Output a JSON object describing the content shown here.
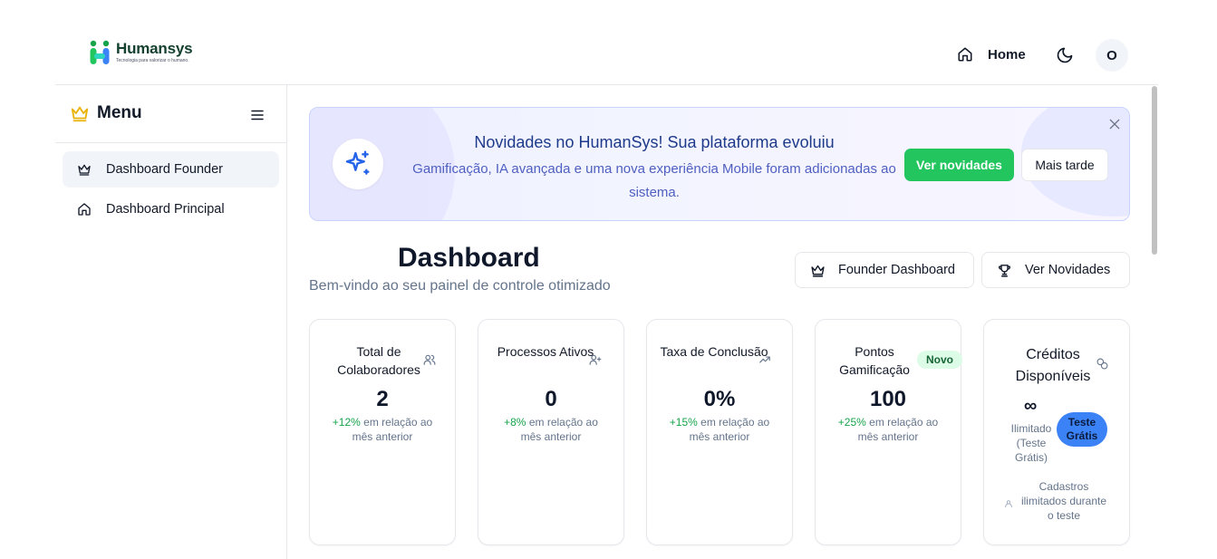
{
  "header": {
    "logo": {
      "name": "Humansys",
      "tagline": "Tecnologia para valorizar o humano."
    },
    "home_label": "Home",
    "avatar_initial": "O"
  },
  "sidebar": {
    "title": "Menu",
    "items": [
      {
        "label": "Dashboard Founder",
        "icon": "crown-icon",
        "active": true
      },
      {
        "label": "Dashboard Principal",
        "icon": "home-icon",
        "active": false
      }
    ]
  },
  "banner": {
    "title": "Novidades no HumanSys! Sua plataforma evoluiu",
    "description": "Gamificação, IA avançada e uma nova experiência Mobile foram adicionadas ao sistema.",
    "primary_button": "Ver novidades",
    "secondary_button": "Mais tarde",
    "icon": "sparkles-icon"
  },
  "dashboard": {
    "title": "Dashboard",
    "subtitle": "Bem-vindo ao seu painel de controle otimizado",
    "founder_button": "Founder Dashboard",
    "news_button": "Ver Novidades"
  },
  "cards": [
    {
      "title": "Total de Colaboradores",
      "value": "2",
      "delta": "+12%",
      "delta_text": " em relação ao mês anterior",
      "icon": "users-icon"
    },
    {
      "title": "Processos Ativos",
      "value": "0",
      "delta": "+8%",
      "delta_text": " em relação ao mês anterior",
      "icon": "user-plus-icon"
    },
    {
      "title": "Taxa de Conclusão",
      "value": "0%",
      "delta": "+15%",
      "delta_text": " em relação ao mês anterior",
      "icon": "trending-up-icon"
    },
    {
      "title": "Pontos Gamificação",
      "value": "100",
      "delta": "+25%",
      "delta_text": " em relação ao mês anterior",
      "badge": "Novo",
      "icon": "trophy-icon"
    },
    {
      "title": "Créditos Disponíveis",
      "value": "∞",
      "value_caption": "Ilimitado (Teste Grátis)",
      "badge": "Teste Grátis",
      "note": "Cadastros ilimitados durante o teste",
      "icon": "coins-icon"
    }
  ],
  "colors": {
    "accent_green": "#22c55e",
    "badge_blue": "#3b82f6",
    "banner_title": "#1e3a8a",
    "positive_delta": "#16a34a"
  }
}
